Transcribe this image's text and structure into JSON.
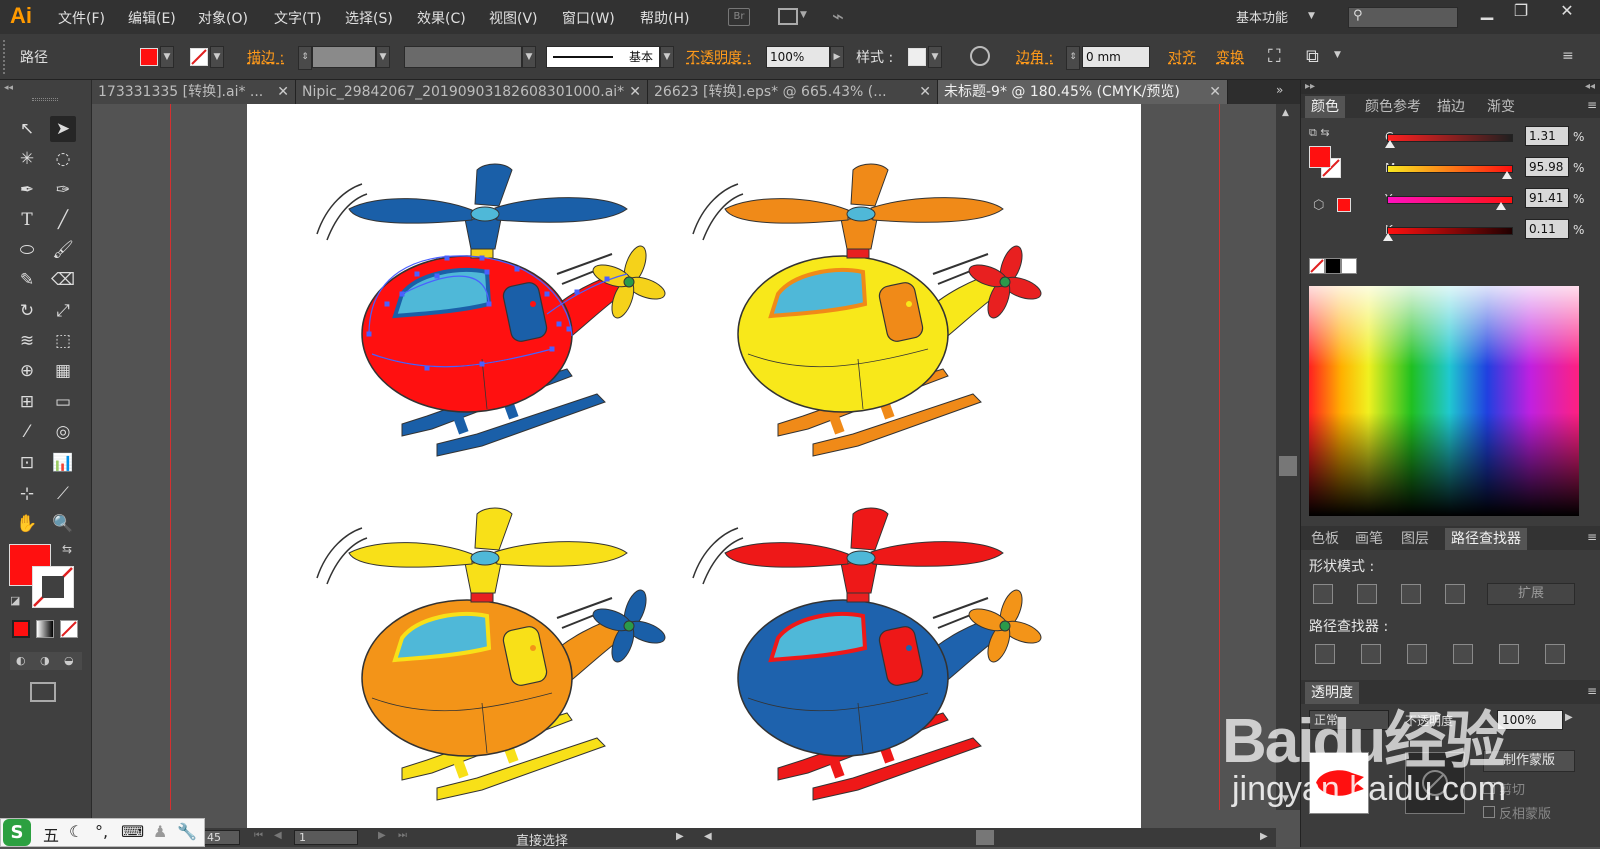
{
  "app": {
    "logo": "Ai"
  },
  "menu": [
    "文件(F)",
    "编辑(E)",
    "对象(O)",
    "文字(T)",
    "选择(S)",
    "效果(C)",
    "视图(V)",
    "窗口(W)",
    "帮助(H)"
  ],
  "menu_icons": {
    "bridge": "Br"
  },
  "workspace": {
    "label": "基本功能"
  },
  "control": {
    "path_label": "路径",
    "stroke_label": "描边 :",
    "opacity_label": "不透明度 :",
    "opacity_value": "100%",
    "style_label": "样式 :",
    "stroke_profile": "基本",
    "corner_label": "边角 :",
    "corner_value": "0 mm",
    "align_label": "对齐",
    "transform_label": "变换"
  },
  "tabs": [
    {
      "label": "173331335 [转换].ai* ..."
    },
    {
      "label": "Nipic_29842067_20190903182608301000.ai*"
    },
    {
      "label": "26623 [转换].eps* @ 665.43% (..."
    },
    {
      "label": "未标题-9* @ 180.45% (CMYK/预览)"
    }
  ],
  "colors": {
    "fill": "#ff1010",
    "accent": "#ff9a1a"
  },
  "color_panel": {
    "tabs": [
      "颜色",
      "颜色参考",
      "描边",
      "渐变"
    ],
    "channels": [
      {
        "name": "C",
        "value": "1.31",
        "fraction": 0.013
      },
      {
        "name": "M",
        "value": "95.98",
        "fraction": 0.96
      },
      {
        "name": "Y",
        "value": "91.41",
        "fraction": 0.914
      },
      {
        "name": "K",
        "value": "0.11",
        "fraction": 0.001
      }
    ],
    "unit": "%"
  },
  "pathfinder_panel": {
    "tabs": [
      "色板",
      "画笔",
      "图层",
      "路径查找器"
    ],
    "shape_modes_label": "形状模式 :",
    "expand_label": "扩展",
    "pathfinders_label": "路径查找器 :"
  },
  "transparency_panel": {
    "title": "透明度",
    "blend": "正常",
    "opacity_label": "不透明度",
    "opacity_value": "100%",
    "make_mask": "制作蒙版",
    "clip": "剪切",
    "invert": "反相蒙版"
  },
  "status": {
    "zoom": "45",
    "page": "1",
    "tool": "直接选择"
  },
  "watermark": {
    "main": "Baidu经验",
    "sub": "jingyan.baidu.com"
  },
  "ime": {
    "mode": "五"
  },
  "helicopters": [
    {
      "body": "#ff1010",
      "rotor": "#1a5fa8",
      "window_frame": "#1a5fa8",
      "tail_rotor": "#f5d21a",
      "skid": "#1a5fa8",
      "selected": true
    },
    {
      "body": "#f8e81a",
      "rotor": "#f08a18",
      "window_frame": "#f08a18",
      "tail_rotor": "#e82020",
      "skid": "#f08a18",
      "selected": false
    },
    {
      "body": "#f39418",
      "rotor": "#f8e018",
      "window_frame": "#f8e018",
      "tail_rotor": "#1a5fa8",
      "skid": "#f8e018",
      "selected": false
    },
    {
      "body": "#1e62ad",
      "rotor": "#ee1818",
      "window_frame": "#ee1818",
      "tail_rotor": "#f39418",
      "skid": "#ee1818",
      "selected": false
    }
  ]
}
